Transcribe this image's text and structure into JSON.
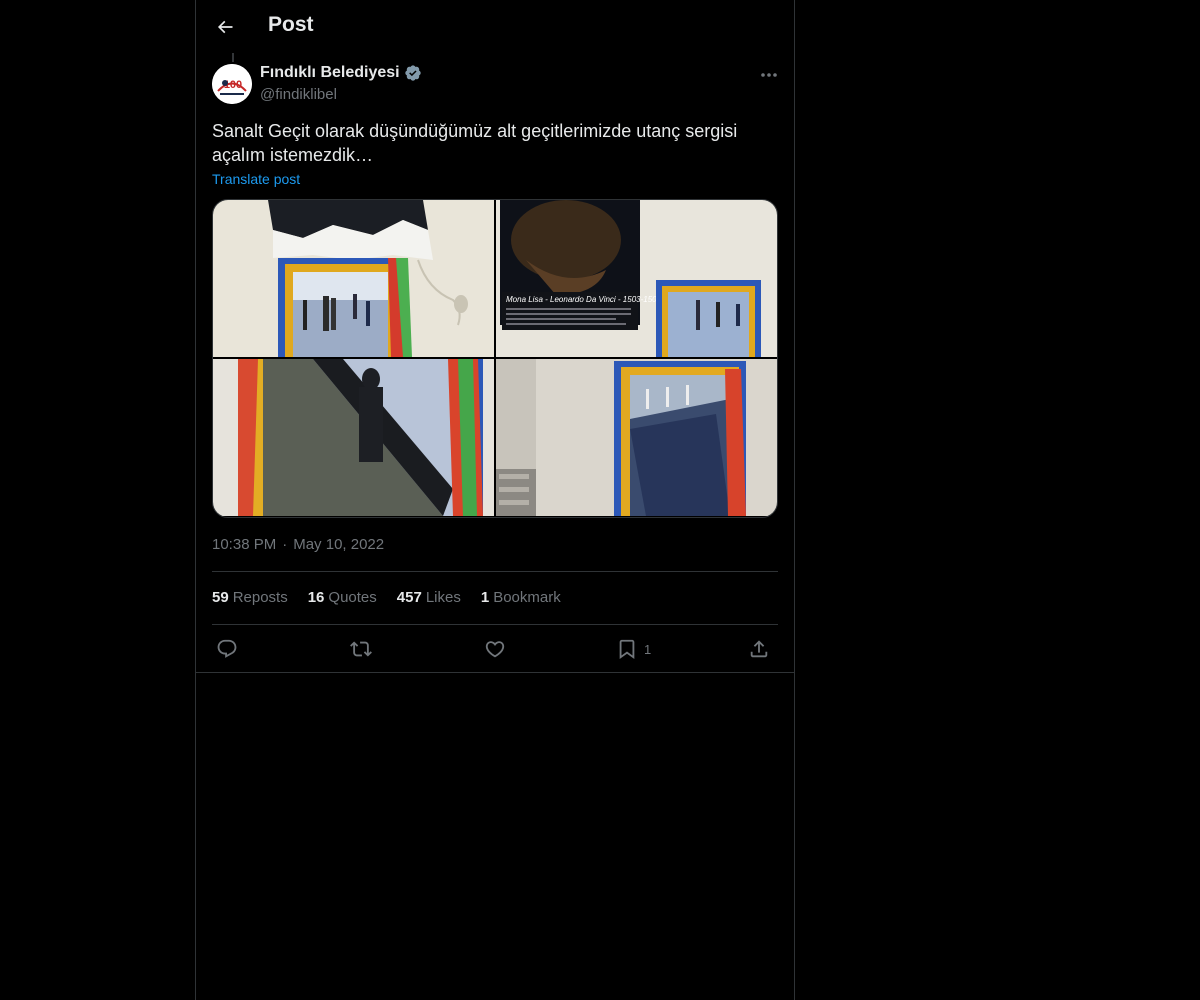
{
  "header": {
    "title": "Post",
    "back_icon": "arrow-left-icon"
  },
  "author": {
    "name": "Fındıklı Belediyesi",
    "handle": "@findiklibel",
    "verified_color": "#829aab",
    "avatar_text": "100"
  },
  "post": {
    "text": "Sanalt Geçit olarak düşündüğümüz alt geçitlerimizde utanç sergisi açalım istemezdik…",
    "translate_label": "Translate post",
    "time": "10:38 PM",
    "separator": "·",
    "date": "May 10, 2022"
  },
  "media": {
    "poster_caption": "Mona Lisa - Leonardo Da Vinci - 1503-1506"
  },
  "stats": [
    {
      "count": "59",
      "label": "Reposts"
    },
    {
      "count": "16",
      "label": "Quotes"
    },
    {
      "count": "457",
      "label": "Likes"
    },
    {
      "count": "1",
      "label": "Bookmark"
    }
  ],
  "actions": {
    "reply_icon": "reply-icon",
    "repost_icon": "repost-icon",
    "like_icon": "heart-icon",
    "bookmark_icon": "bookmark-icon",
    "bookmark_count": "1",
    "share_icon": "share-icon"
  },
  "colors": {
    "background": "#000000",
    "border": "#2f3336",
    "text_primary": "#e7e9ea",
    "text_secondary": "#71767b",
    "link": "#1d9bf0"
  }
}
